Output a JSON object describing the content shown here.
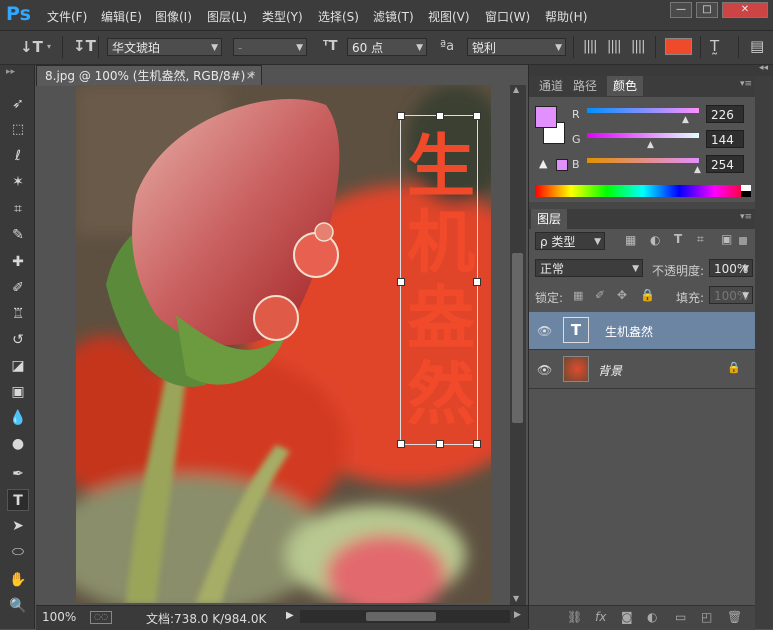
{
  "app": {
    "logo": "Ps"
  },
  "menu": [
    "文件(F)",
    "编辑(E)",
    "图像(I)",
    "图层(L)",
    "类型(Y)",
    "选择(S)",
    "滤镜(T)",
    "视图(V)",
    "窗口(W)",
    "帮助(H)"
  ],
  "window_controls": {
    "minimize": "—",
    "restore": "□",
    "close": "✕"
  },
  "options": {
    "font_family": "华文琥珀",
    "font_style": "-",
    "font_size": "60 点",
    "aa_label": "ªa",
    "aa_mode": "锐利",
    "color_swatch": "#f04a2c"
  },
  "document": {
    "tab_title": "8.jpg @ 100% (生机盎然, RGB/8#) *",
    "zoom": "100%",
    "doc_info": "文档:738.0 K/984.0K"
  },
  "canvas_text": [
    "生",
    "机",
    "盎",
    "然"
  ],
  "color_panel": {
    "tabs": [
      "通道",
      "路径",
      "颜色"
    ],
    "active_tab": "颜色",
    "channels": [
      {
        "label": "R",
        "value": "226"
      },
      {
        "label": "G",
        "value": "144"
      },
      {
        "label": "B",
        "value": "254"
      }
    ],
    "foreground": "#e290fe",
    "background": "#ffffff"
  },
  "layers_panel": {
    "tab": "图层",
    "filter_label": "ρ 类型",
    "blend_mode": "正常",
    "opacity_label": "不透明度:",
    "opacity_value": "100%",
    "lock_label": "锁定:",
    "fill_label": "填充:",
    "fill_value": "100%",
    "layers": [
      {
        "name": "生机盎然",
        "type": "text",
        "selected": true
      },
      {
        "name": "背景",
        "type": "image",
        "selected": false,
        "locked": true
      }
    ]
  }
}
